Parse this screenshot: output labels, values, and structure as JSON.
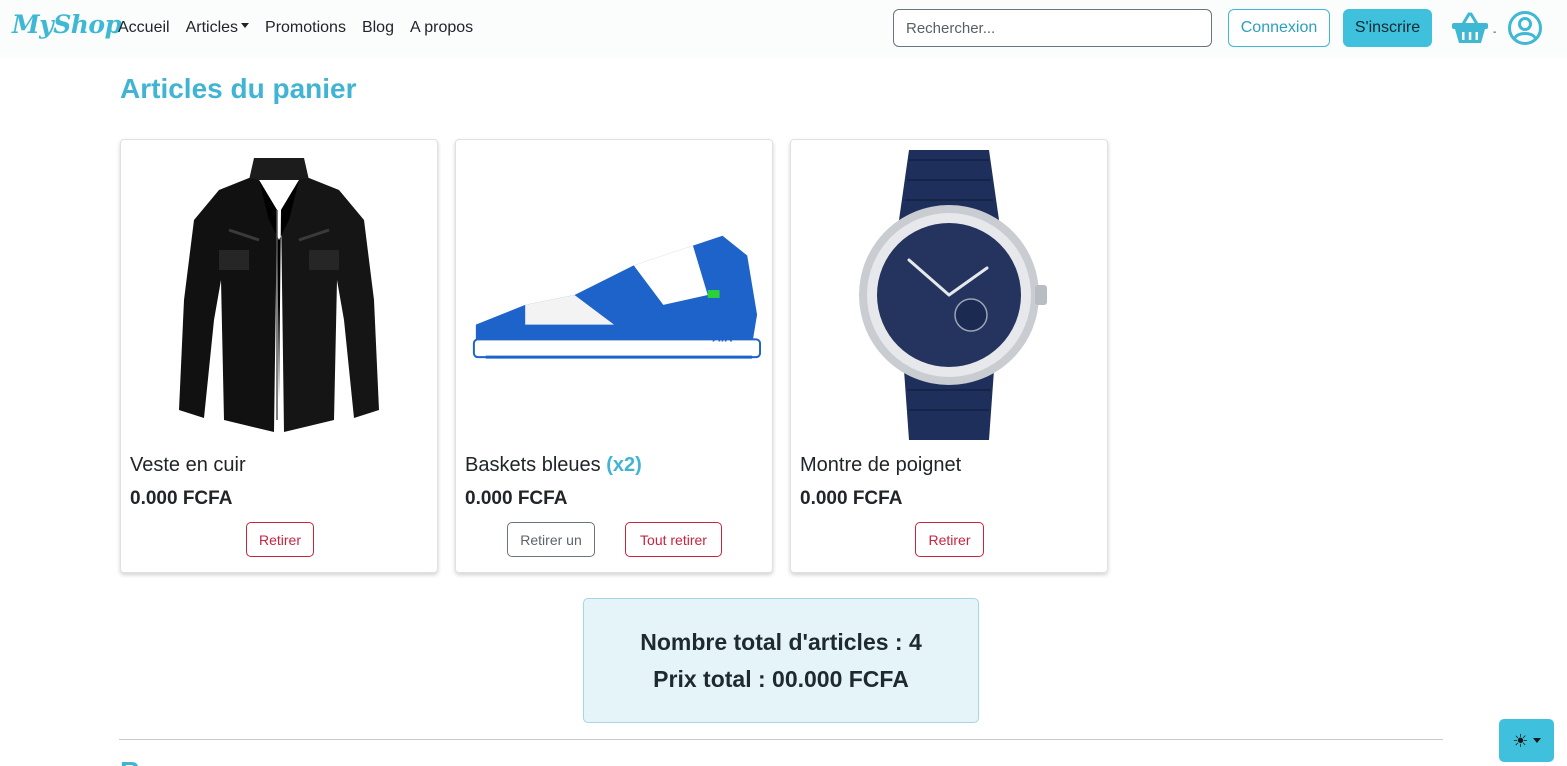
{
  "navbar": {
    "brand": "MyShop",
    "links": [
      {
        "label": "Accueil"
      },
      {
        "label": "Articles",
        "dropdown": true
      },
      {
        "label": "Promotions"
      },
      {
        "label": "Blog"
      },
      {
        "label": "A propos"
      }
    ],
    "search_placeholder": "Rechercher...",
    "login_label": "Connexion",
    "signup_label": "S'inscrire",
    "cart_count": "-",
    "cart_icon": "basket-icon",
    "user_icon": "user-circle-icon"
  },
  "main": {
    "title": "Articles du panier",
    "items": [
      {
        "name": "Veste en cuir",
        "quantity": "",
        "price": "0.000 FCFA",
        "image": "leather-jacket-image",
        "remove_label": "Retirer"
      },
      {
        "name": "Baskets bleues",
        "quantity": "(x2)",
        "price": "0.000 FCFA",
        "image": "blue-sneaker-image",
        "remove_one_label": "Retirer un",
        "remove_all_label": "Tout retirer"
      },
      {
        "name": "Montre de poignet",
        "quantity": "",
        "price": "0.000 FCFA",
        "image": "wrist-watch-image",
        "remove_label": "Retirer"
      }
    ],
    "summary": {
      "total_items": "Nombre total d'articles : 4",
      "total_price": "Prix total : 00.000 FCFA"
    },
    "next_section_title": "Bon"
  },
  "theme_toggle": {
    "icon": "sun-icon"
  },
  "colors": {
    "accent": "#42b4d3",
    "button_info": "#3fc0dc",
    "danger": "#c8233f",
    "summary_bg": "#e4f4f9"
  }
}
